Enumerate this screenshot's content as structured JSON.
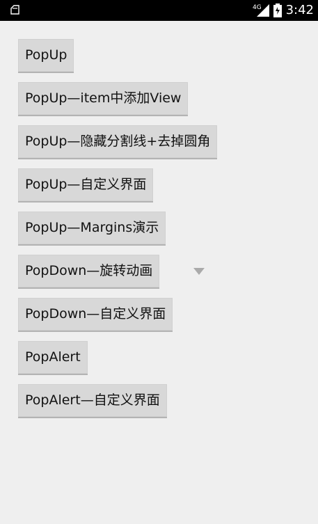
{
  "status_bar": {
    "time": "3:42",
    "network_label": "4G",
    "icons": [
      "notification-icon",
      "signal-icon",
      "battery-icon"
    ]
  },
  "buttons": [
    {
      "label": "PopUp"
    },
    {
      "label": "PopUp—item中添加View"
    },
    {
      "label": "PopUp—隐藏分割线+去掉圆角"
    },
    {
      "label": "PopUp—自定义界面"
    },
    {
      "label": "PopUp—Margins演示"
    },
    {
      "label": "PopDown—旋转动画"
    },
    {
      "label": "PopDown—自定义界面"
    },
    {
      "label": "PopAlert"
    },
    {
      "label": "PopAlert—自定义界面"
    }
  ],
  "colors": {
    "statusbar_bg": "#000000",
    "background": "#efefef",
    "button_bg": "#d8d8d8",
    "spinner_arrow": "#aaaaaa"
  }
}
